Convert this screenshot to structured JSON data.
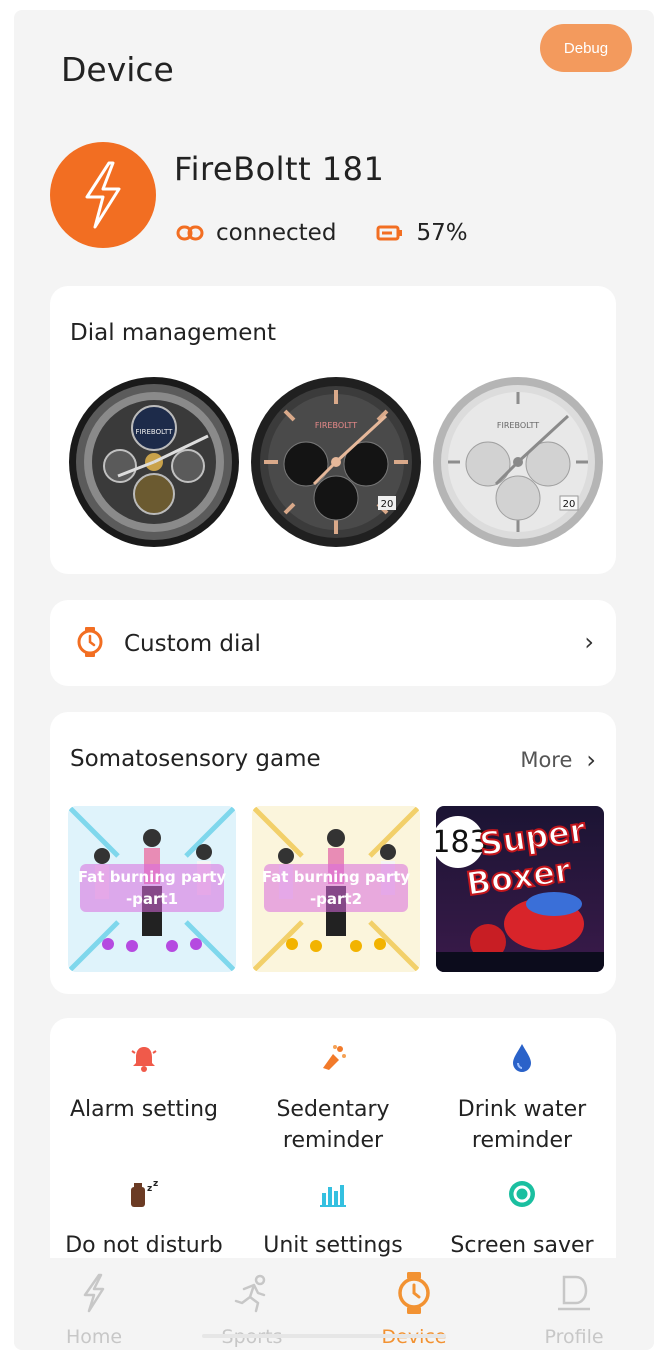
{
  "header": {
    "title": "Device",
    "debug_label": "Debug"
  },
  "device": {
    "name": "FireBoltt 181",
    "connection_status": "connected",
    "battery": "57%",
    "logo_icon": "lightning-bolt-icon"
  },
  "dial_management": {
    "title": "Dial management",
    "dials": [
      {
        "name": "skeleton-chronograph-dial",
        "brand": "FIREBOLTT"
      },
      {
        "name": "black-rose-gold-chronograph-dial",
        "brand": "FIREBOLTT",
        "date": "20"
      },
      {
        "name": "silver-chronograph-dial",
        "brand": "FIREBOLTT",
        "date": "20"
      }
    ]
  },
  "custom_dial": {
    "label": "Custom dial",
    "icon": "watch-icon"
  },
  "games": {
    "title": "Somatosensory game",
    "more_label": "More",
    "items": [
      {
        "title_line1": "Fat burning party",
        "title_line2": "-part1"
      },
      {
        "title_line1": "Fat burning party",
        "title_line2": "-part2"
      },
      {
        "title_line1": "Super",
        "title_line2": "Boxer",
        "badge": "183"
      }
    ]
  },
  "settings": [
    {
      "label_line1": "Alarm setting",
      "label_line2": "",
      "icon": "alarm-bell-icon",
      "color": "#f05a4a"
    },
    {
      "label_line1": "Sedentary",
      "label_line2": "reminder",
      "icon": "sedentary-icon",
      "color": "#f27a2a"
    },
    {
      "label_line1": "Drink water",
      "label_line2": "reminder",
      "icon": "water-drop-icon",
      "color": "#2a62c9"
    },
    {
      "label_line1": "Do not disturb",
      "label_line2": "",
      "icon": "do-not-disturb-icon",
      "color": "#6b3b24"
    },
    {
      "label_line1": "Unit settings",
      "label_line2": "",
      "icon": "unit-settings-icon",
      "color": "#34c0e0"
    },
    {
      "label_line1": "Screen saver",
      "label_line2": "",
      "icon": "screen-saver-icon",
      "color": "#1bbfa0"
    }
  ],
  "tabbar": {
    "items": [
      {
        "label": "Home",
        "icon": "home-bolt-icon"
      },
      {
        "label": "Sports",
        "icon": "running-icon"
      },
      {
        "label": "Device",
        "icon": "watch-icon",
        "active": true
      },
      {
        "label": "Profile",
        "icon": "profile-icon"
      }
    ]
  },
  "colors": {
    "accent": "#f26e22",
    "active_tab": "#f29232",
    "debug_button": "#f39a5d"
  }
}
